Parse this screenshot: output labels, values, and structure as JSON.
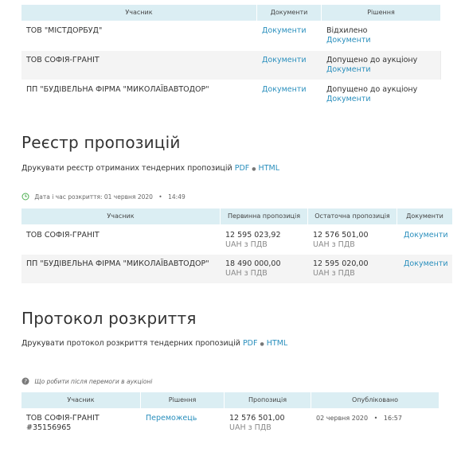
{
  "participants": {
    "headers": {
      "participant": "Учасник",
      "documents": "Документи",
      "decision": "Рішення"
    },
    "rows": [
      {
        "name": "ТОВ \"МІСТДОРБУД\"",
        "documents": "Документи",
        "status": "Відхилено",
        "status_docs": "Документи"
      },
      {
        "name": "ТОВ СОФІЯ-ГРАНІТ",
        "documents": "Документи",
        "status": "Допущено до аукціону",
        "status_docs": "Документи"
      },
      {
        "name": "ПП \"БУДІВЕЛЬНА ФІРМА \"МИКОЛАЇВАВТОДОР\"",
        "documents": "Документи",
        "status": "Допущено до аукціону",
        "status_docs": "Документи"
      }
    ]
  },
  "registry": {
    "title": "Реєстр пропозицій",
    "print_text": "Друкувати реєстр отриманих тендерних пропозицій",
    "pdf": "PDF",
    "sep": "●",
    "html": "HTML",
    "opened_label": "Дата і час розкриття: 01 червня 2020",
    "opened_dot": "•",
    "opened_time": "14:49",
    "headers": {
      "participant": "Учасник",
      "initial": "Первинна пропозиція",
      "final": "Остаточна пропозиція",
      "documents": "Документи"
    },
    "rows": [
      {
        "name": "ТОВ СОФІЯ-ГРАНІТ",
        "initial": "12 595 023,92",
        "initial_unit": "UAH з ПДВ",
        "final": "12 576 501,00",
        "final_unit": "UAH з ПДВ",
        "documents": "Документи"
      },
      {
        "name": "ПП \"БУДІВЕЛЬНА ФІРМА \"МИКОЛАЇВАВТОДОР\"",
        "initial": "18 490 000,00",
        "initial_unit": "UAH з ПДВ",
        "final": "12 595 020,00",
        "final_unit": "UAH з ПДВ",
        "documents": "Документи"
      }
    ]
  },
  "protocol": {
    "title": "Протокол розкриття",
    "print_text": "Друкувати протокол розкриття тендерних пропозицій",
    "pdf": "PDF",
    "sep": "●",
    "html": "HTML"
  },
  "after_win": {
    "help_text": "Що робити після перемоги в аукціоні",
    "headers": {
      "participant": "Учасник",
      "decision": "Рішення",
      "offer": "Пропозиція",
      "published": "Опубліковано"
    },
    "row": {
      "name": "ТОВ СОФІЯ-ГРАНІТ",
      "code": "#35156965",
      "decision": "Переможець",
      "offer": "12 576 501,00",
      "offer_unit": "UAH з ПДВ",
      "published_date": "02 червня 2020",
      "published_dot": "•",
      "published_time": "16:57"
    }
  },
  "colors": {
    "header_bg": "#dbeef3",
    "link": "#2a8fbd",
    "clock": "#4caf50"
  }
}
